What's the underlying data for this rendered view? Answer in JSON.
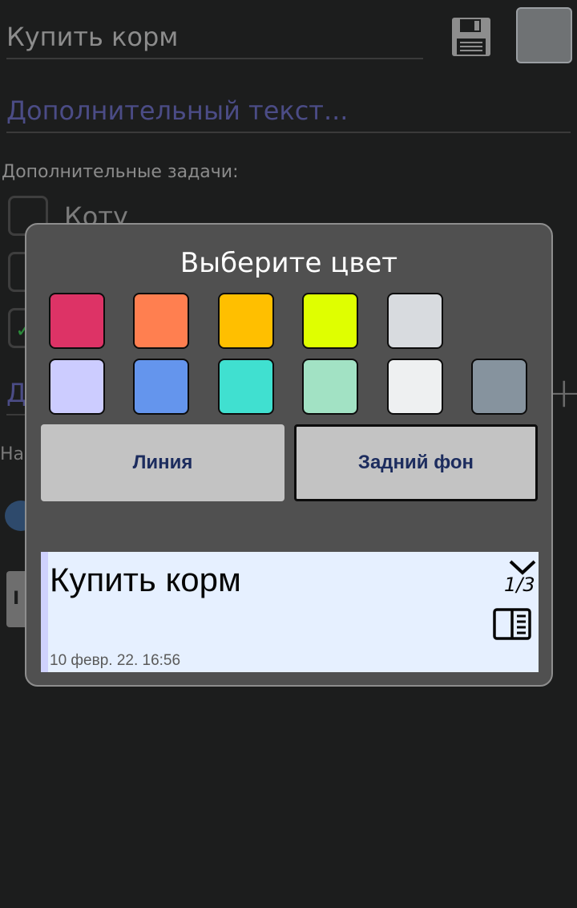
{
  "editor": {
    "title_value": "Купить корм",
    "extra_text_placeholder": "Дополнительный текст...",
    "subtasks_label": "Дополнительные задачи:",
    "first_subtask": "Коту",
    "partial_field_letter": "Д",
    "partial_label": "На",
    "partial_button_letter": "I",
    "current_color": "#6f7274"
  },
  "dialog": {
    "title": "Выберите цвет",
    "swatches_row1": [
      "#dd3366",
      "#ff7f50",
      "#ffbf00",
      "#dfff00",
      "#d8dbdf"
    ],
    "swatches_row2": [
      "#ccccff",
      "#6495ed",
      "#40e0d0",
      "#a2e2c4",
      "#eef0f1",
      "#86939e"
    ],
    "line_button": "Линия",
    "background_button": "Задний фон",
    "selected_mode": "background"
  },
  "preview": {
    "title": "Купить корм",
    "counter": "1/3",
    "date": "10 февр. 22. 16:56",
    "background_color": "#e6f0ff",
    "line_color": "#cfd2fe"
  }
}
